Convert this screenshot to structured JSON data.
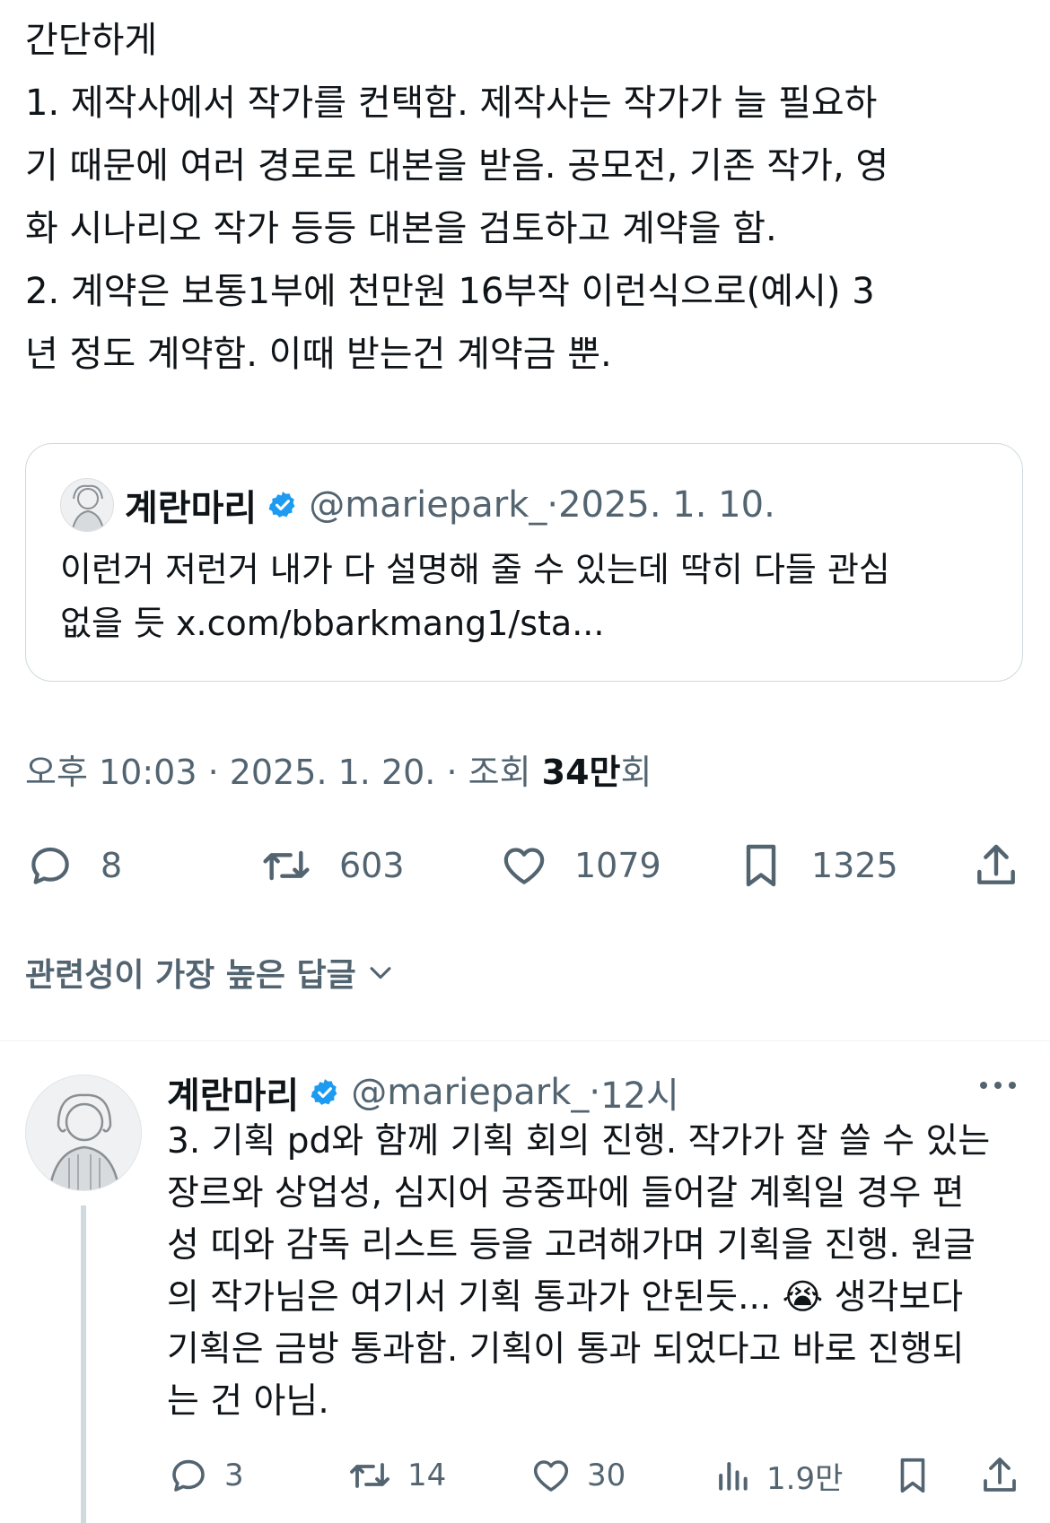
{
  "tweet": {
    "text": "간단하게\n1. 제작사에서 작가를 컨택함. 제작사는 작가가 늘 필요하\n기 때문에 여러 경로로 대본을 받음. 공모전, 기존 작가, 영\n화 시나리오 작가 등등 대본을 검토하고 계약을 함.\n2. 계약은 보통1부에 천만원 16부작 이런식으로(예시) 3\n년 정도 계약함. 이때 받는건 계약금 뿐."
  },
  "quoted": {
    "name": "계란마리",
    "handle": "@mariepark_",
    "dot": " · ",
    "date": "2025. 1. 10.",
    "text": "이런거 저런거 내가 다 설명해 줄 수 있는데 딱히 다들 관심\n없을 듯 x.com/bbarkmang1/sta..."
  },
  "meta": {
    "time_date": "오후 10:03 · 2025. 1. 20. · 조회 ",
    "views_num": "34만",
    "views_suffix": "회"
  },
  "actions": {
    "replies": "8",
    "retweets": "603",
    "likes": "1079",
    "bookmarks": "1325"
  },
  "replies_sort_label": "관련성이 가장 높은 답글",
  "reply": {
    "name": "계란마리",
    "handle": "@mariepark_",
    "dot": " · ",
    "time": "12시",
    "text": "3. 기획 pd와 함께 기획 회의 진행. 작가가 잘 쓸 수 있는\n장르와 상업성, 심지어 공중파에 들어갈 계획일 경우 편\n성 띠와 감독 리스트 등을 고려해가며 기획을 진행. 원글\n의 작가님은 여기서 기획 통과가 안된듯... 😭 생각보다\n기획은  금방 통과함. 기획이 통과 되었다고 바로 진행되\n는 건 아님.",
    "replies": "3",
    "retweets": "14",
    "likes": "30",
    "views": "1.9만"
  },
  "colors": {
    "text": "#0f1419",
    "secondary": "#536471",
    "verified": "#1d9bf0",
    "border": "#cfd9de"
  }
}
